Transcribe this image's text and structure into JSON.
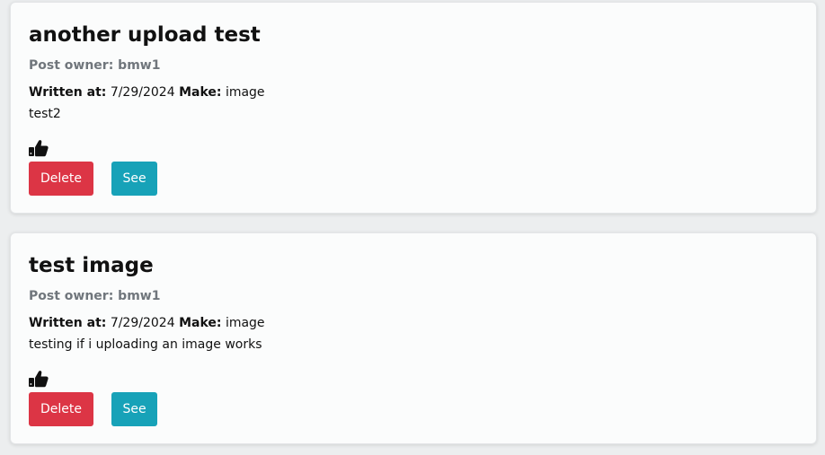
{
  "posts": [
    {
      "title": "another upload test",
      "owner": "Post owner: bmw1",
      "written_label": "Written at:",
      "date": "7/29/2024",
      "make_label": "Make:",
      "make": "image",
      "content": "test2",
      "like_icon": "thumbs-up-icon",
      "delete_label": "Delete",
      "see_label": "See"
    },
    {
      "title": "test image",
      "owner": "Post owner: bmw1",
      "written_label": "Written at:",
      "date": "7/29/2024",
      "make_label": "Make:",
      "make": "image",
      "content": "testing if i uploading an image works",
      "like_icon": "thumbs-up-icon",
      "delete_label": "Delete",
      "see_label": "See"
    }
  ],
  "colors": {
    "delete": "#dc3545",
    "see": "#17a2b8",
    "owner_text": "#70767c",
    "card_bg": "#fbfcfc",
    "page_bg": "#eceeef"
  }
}
